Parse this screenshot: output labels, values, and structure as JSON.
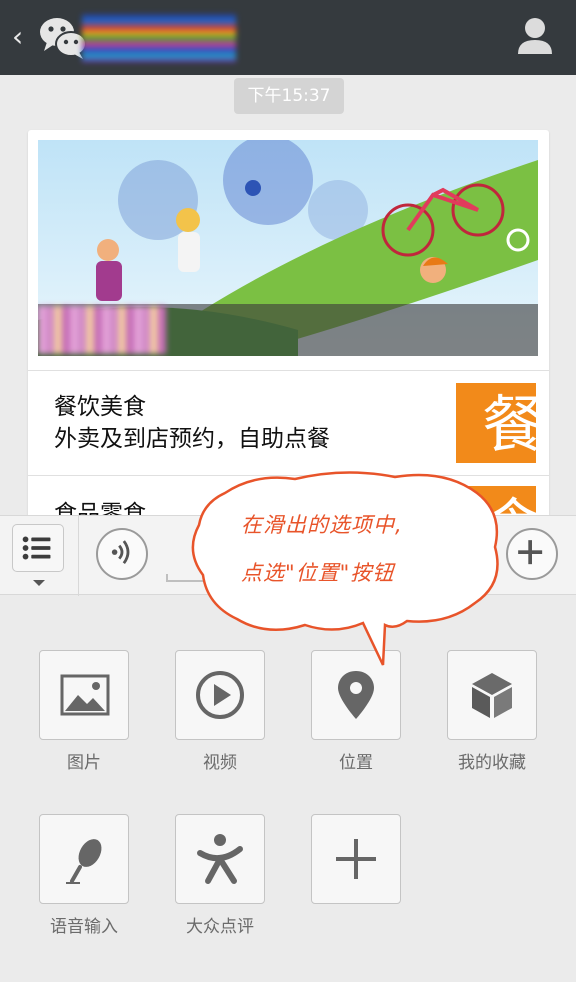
{
  "header": {
    "back_icon": "chevron-left-icon",
    "back_glyph": "‹",
    "app_icon": "wechat-logo",
    "contact_icon": "person-icon"
  },
  "chat": {
    "time": "下午15:37",
    "card": {
      "items": [
        {
          "line1": "餐饮美食",
          "line2": "外卖及到店预约，自助点餐",
          "thumb_glyph": "餐",
          "thumb_color": "#f28a1a"
        },
        {
          "line1": "食品零食",
          "thumb_glyph": "食",
          "thumb_color": "#f28a1a"
        }
      ]
    }
  },
  "toolbar": {
    "menu_icon": "list-icon",
    "voice_icon": "voice-icon",
    "more_icon": "plus-circle-icon"
  },
  "callout": {
    "line1": "在滑出的选项中,",
    "line2": "点选\"位置\"按钮",
    "color": "#e8542a"
  },
  "panel": {
    "items": [
      {
        "label": "图片",
        "icon": "image-icon"
      },
      {
        "label": "视频",
        "icon": "video-play-icon"
      },
      {
        "label": "位置",
        "icon": "location-pin-icon"
      },
      {
        "label": "我的收藏",
        "icon": "cube-icon"
      },
      {
        "label": "语音输入",
        "icon": "microphone-icon"
      },
      {
        "label": "大众点评",
        "icon": "dianping-icon"
      },
      {
        "label": "",
        "icon": "add-icon"
      }
    ]
  }
}
